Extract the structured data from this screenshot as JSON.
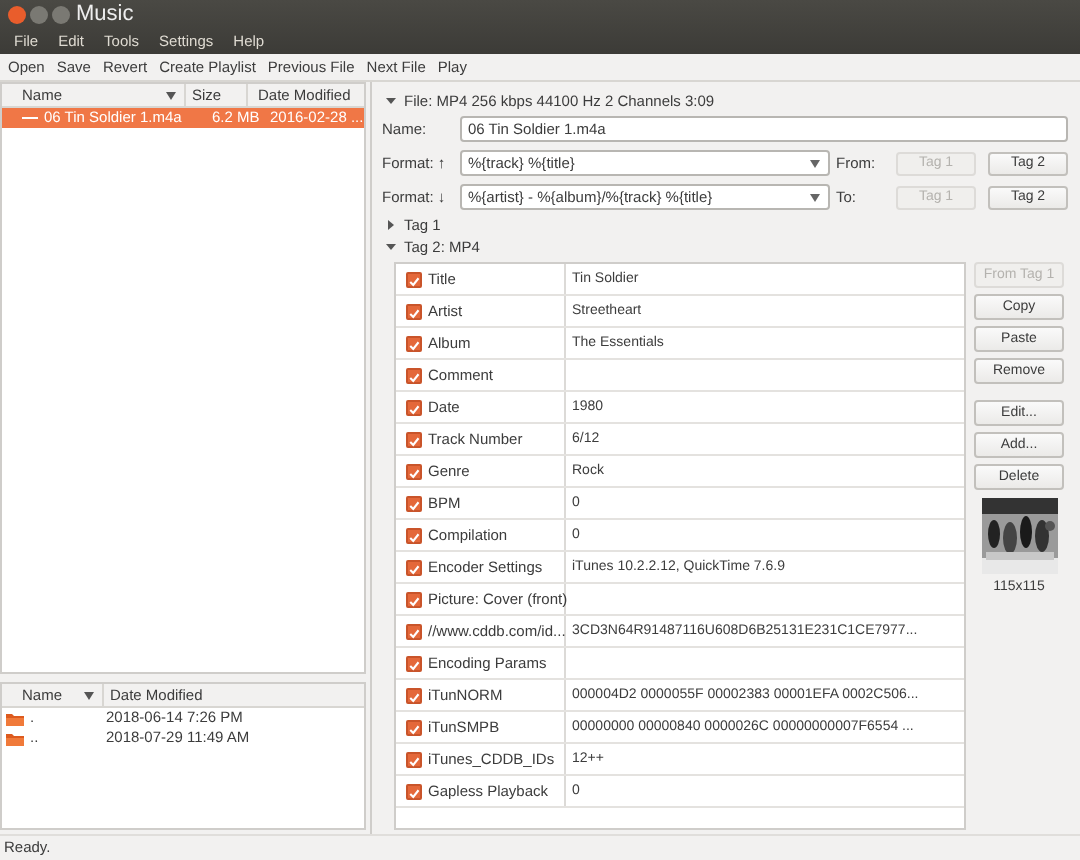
{
  "window": {
    "title": "Music"
  },
  "menu": [
    "File",
    "Edit",
    "Tools",
    "Settings",
    "Help"
  ],
  "toolbar": [
    "Open",
    "Save",
    "Revert",
    "Create Playlist",
    "Previous File",
    "Next File",
    "Play"
  ],
  "file_list": {
    "columns": [
      "Name",
      "Size",
      "Date Modified"
    ],
    "rows": [
      {
        "name": "06 Tin Soldier 1.m4a",
        "size": "6.2 MB",
        "date": "2016-02-28 ...",
        "selected": true
      }
    ]
  },
  "dir_list": {
    "columns": [
      "Name",
      "Date Modified"
    ],
    "rows": [
      {
        "name": ".",
        "date": "2018-06-14 7:26 PM"
      },
      {
        "name": "..",
        "date": "2018-07-29 11:49 AM"
      }
    ]
  },
  "file_info": "File: MP4 256 kbps 44100 Hz 2 Channels 3:09",
  "name_field": {
    "label": "Name:",
    "value": "06 Tin Soldier 1.m4a"
  },
  "formats": [
    {
      "label": "Format: ↑",
      "value": "%{track} %{title}",
      "direction": "From:",
      "buttons": [
        {
          "label": "Tag 1",
          "disabled": true
        },
        {
          "label": "Tag 2",
          "disabled": false
        }
      ]
    },
    {
      "label": "Format: ↓",
      "value": "%{artist} - %{album}/%{track} %{title}",
      "direction": "To:",
      "buttons": [
        {
          "label": "Tag 1",
          "disabled": true
        },
        {
          "label": "Tag 2",
          "disabled": false
        }
      ]
    }
  ],
  "sections": [
    {
      "label": "Tag 1",
      "expanded": false
    },
    {
      "label": "Tag 2: MP4",
      "expanded": true
    }
  ],
  "frames": [
    {
      "name": "Title",
      "value": "Tin Soldier",
      "checked": true
    },
    {
      "name": "Artist",
      "value": "Streetheart",
      "checked": true
    },
    {
      "name": "Album",
      "value": "The Essentials",
      "checked": true
    },
    {
      "name": "Comment",
      "checked": true
    },
    {
      "name": "Date",
      "value": "1980",
      "checked": true
    },
    {
      "name": "Track Number",
      "value": "6/12",
      "checked": true
    },
    {
      "name": "Genre",
      "value": "Rock",
      "checked": true
    },
    {
      "name": "BPM",
      "value": "0",
      "checked": true
    },
    {
      "name": "Compilation",
      "value": "0",
      "checked": true
    },
    {
      "name": "Encoder Settings",
      "value": "iTunes 10.2.2.12, QuickTime 7.6.9",
      "checked": true
    },
    {
      "name": "Picture: Cover (front)",
      "checked": true
    },
    {
      "name": "//www.cddb.com/id...",
      "value": "3CD3N64R91487116U608D6B25131E231C1CE7977...",
      "checked": true
    },
    {
      "name": "Encoding Params",
      "checked": true
    },
    {
      "name": "iTunNORM",
      "value": "000004D2 0000055F 00002383 00001EFA 0002C506...",
      "checked": true
    },
    {
      "name": "iTunSMPB",
      "value": "00000000 00000840 0000026C 00000000007F6554 ...",
      "checked": true
    },
    {
      "name": "iTunes_CDDB_IDs",
      "value": "12++",
      "checked": true
    },
    {
      "name": "Gapless Playback",
      "value": "0",
      "checked": true
    }
  ],
  "side_buttons": [
    {
      "label": "From Tag 1",
      "disabled": true
    },
    {
      "label": "Copy",
      "disabled": false
    },
    {
      "label": "Paste",
      "disabled": false
    },
    {
      "label": "Remove",
      "disabled": false
    },
    {
      "label": "Edit...",
      "disabled": false
    },
    {
      "label": "Add...",
      "disabled": false
    },
    {
      "label": "Delete",
      "disabled": false
    }
  ],
  "cover": {
    "kind": "picture",
    "size": "115x115"
  },
  "status_bar": "Ready."
}
